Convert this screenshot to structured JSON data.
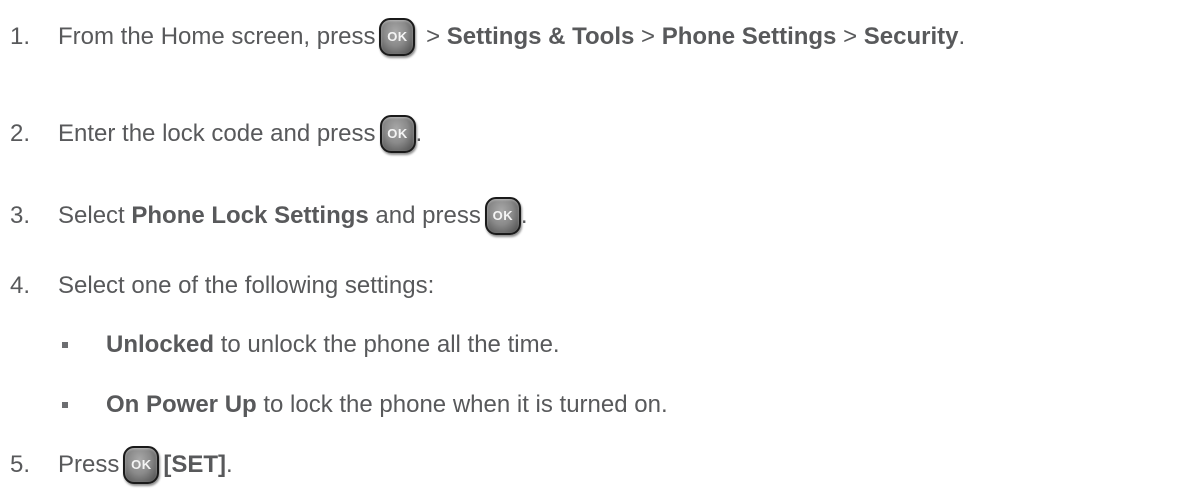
{
  "ok_key_label": "OK",
  "steps": [
    {
      "num": "1.",
      "prefix": "From the Home screen, press",
      "sep1": " > ",
      "b1": "Settings & Tools",
      "sep2": " > ",
      "b2": "Phone Settings",
      "sep3": " > ",
      "b3": "Security",
      "end": "."
    },
    {
      "num": "2.",
      "prefix": "Enter the lock code and press",
      "end": "."
    },
    {
      "num": "3.",
      "prefix": "Select ",
      "b1": "Phone Lock Settings",
      "mid": " and press",
      "end": "."
    },
    {
      "num": "4.",
      "text": "Select one of the following settings:"
    },
    {
      "num": "5.",
      "prefix": "Press",
      "b1": "[SET]",
      "end": "."
    }
  ],
  "options": [
    {
      "bold": "Unlocked",
      "rest": " to unlock the phone all the time."
    },
    {
      "bold": "On Power Up",
      "rest": " to lock the phone when it is turned on."
    }
  ]
}
